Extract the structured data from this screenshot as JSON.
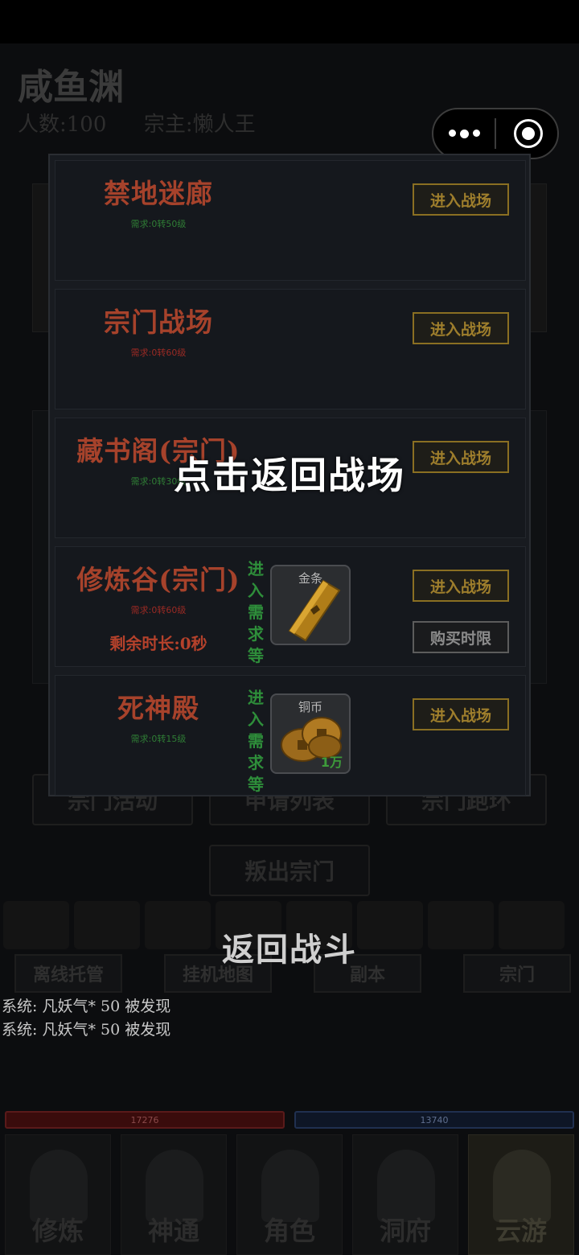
{
  "background": {
    "sect_name": "咸鱼渊",
    "member_label": "人数:100",
    "leader_label": "宗主:懒人王",
    "buttons": [
      "宗门活动",
      "申请列表",
      "宗门跑环"
    ],
    "leave_button": "叛出宗门",
    "tabs": [
      "离线托管",
      "挂机地图",
      "副本",
      "宗门"
    ],
    "system_messages": [
      "系统: 凡妖气* 50  被发现",
      "系统: 凡妖气* 50  被发现"
    ],
    "hp_value": "17276",
    "mp_value": "13740",
    "nav": [
      "修炼",
      "神通",
      "角色",
      "洞府",
      "云游"
    ]
  },
  "battle_panel": {
    "cards": [
      {
        "name": "禁地迷廊",
        "requirement": "需求:0转50级",
        "req_color": "#2f7d35",
        "enter_label": "进入战场"
      },
      {
        "name": "宗门战场",
        "requirement": "需求:0转60级",
        "req_color": "#9a2a24",
        "enter_label": "进入战场"
      },
      {
        "name": "藏书阁(宗门)",
        "requirement": "需求:0转30级",
        "req_color": "#2f7d35",
        "enter_label": "进入战场"
      },
      {
        "name": "修炼谷(宗门)",
        "requirement": "需求:0转60级",
        "req_color": "#9a2a24",
        "remaining": "剩余时长:0秒",
        "entry_note": "进入需求等",
        "item_name": "金条",
        "item_icon": "gold-bar-icon",
        "enter_label": "进入战场",
        "buy_label": "购买时限"
      },
      {
        "name": "死神殿",
        "requirement": "需求:0转15级",
        "req_color": "#2f7d35",
        "entry_note": "进入需求等",
        "item_name": "铜币",
        "item_icon": "copper-coins-icon",
        "item_qty": "1万",
        "enter_label": "进入战场"
      }
    ]
  },
  "overlay": {
    "center_hint": "点击返回战场",
    "return_battle": "返回战斗"
  },
  "colors": {
    "accent_gold": "#9e7e2c",
    "title_red": "#a6422b",
    "req_green": "#2f7d35",
    "req_red": "#9a2a24"
  }
}
